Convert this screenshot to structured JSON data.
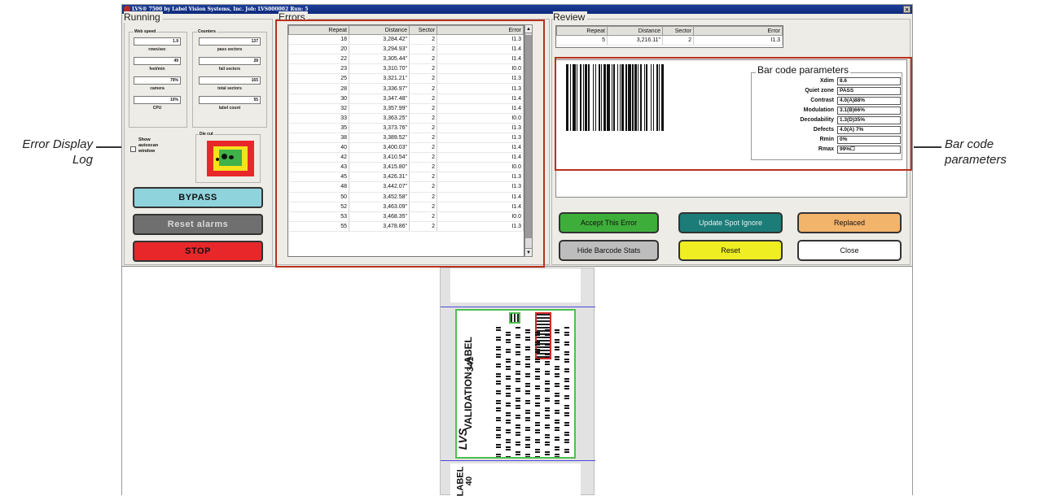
{
  "window": {
    "title": "LVS® 7500 by Label Vision Systems, Inc.   Job: LVS000002   Run: 5",
    "close_glyph": "×"
  },
  "running": {
    "title": "Running",
    "web_speed_title": "Web speed",
    "counters_title": "Counters",
    "rows_per_sec": {
      "value": "1.9",
      "label": "rows/sec"
    },
    "feet_per_min": {
      "value": "49",
      "label": "feet/min"
    },
    "camera": {
      "value": "79%",
      "label": "camera"
    },
    "cpu": {
      "value": "10%",
      "label": "CPU"
    },
    "pass_sectors": {
      "value": "137",
      "label": "pass sectors"
    },
    "fail_sectors": {
      "value": "28",
      "label": "fail sectors"
    },
    "total_sectors": {
      "value": "165",
      "label": "total sectors"
    },
    "label_count": {
      "value": "55",
      "label": "label count"
    },
    "show_autoscan_label": "Show autoscan window",
    "die_cut_title": "Die cut",
    "bypass_label": "BYPASS",
    "reset_alarms_label": "Reset alarms",
    "stop_label": "STOP"
  },
  "errors": {
    "title": "Errors",
    "columns": [
      "Repeat",
      "Distance",
      "Sector",
      "Error"
    ],
    "rows": [
      [
        "18",
        "3,284.42\"",
        "2",
        "I1.3"
      ],
      [
        "20",
        "3,294.93\"",
        "2",
        "I1.4"
      ],
      [
        "22",
        "3,305.44\"",
        "2",
        "I1.4"
      ],
      [
        "23",
        "3,310.70\"",
        "2",
        "I0.0"
      ],
      [
        "25",
        "3,321.21\"",
        "2",
        "I1.3"
      ],
      [
        "28",
        "3,336.97\"",
        "2",
        "I1.3"
      ],
      [
        "30",
        "3,347.48\"",
        "2",
        "I1.4"
      ],
      [
        "32",
        "3,357.99\"",
        "2",
        "I1.4"
      ],
      [
        "33",
        "3,363.25\"",
        "2",
        "I0.0"
      ],
      [
        "35",
        "3,373.76\"",
        "2",
        "I1.3"
      ],
      [
        "38",
        "3,389.52\"",
        "2",
        "I1.3"
      ],
      [
        "40",
        "3,400.03\"",
        "2",
        "I1.4"
      ],
      [
        "42",
        "3,410.54\"",
        "2",
        "I1.4"
      ],
      [
        "43",
        "3,415.80\"",
        "2",
        "I0.0"
      ],
      [
        "45",
        "3,426.31\"",
        "2",
        "I1.3"
      ],
      [
        "48",
        "3,442.07\"",
        "2",
        "I1.3"
      ],
      [
        "50",
        "3,452.58\"",
        "2",
        "I1.4"
      ],
      [
        "52",
        "3,463.09\"",
        "2",
        "I1.4"
      ],
      [
        "53",
        "3,468.35\"",
        "2",
        "I0.0"
      ],
      [
        "55",
        "3,478.86\"",
        "2",
        "I1.3"
      ]
    ]
  },
  "review": {
    "title": "Review",
    "columns": [
      "Repeat",
      "Distance",
      "Sector",
      "Error"
    ],
    "row": [
      "5",
      "3,216.11\"",
      "2",
      "I1.3"
    ]
  },
  "barcode_params": {
    "title": "Bar code parameters",
    "items": [
      {
        "name": "Xdim",
        "value": "8.6"
      },
      {
        "name": "Quiet zone",
        "value": "PASS"
      },
      {
        "name": "Contrast",
        "value": "4.0(A)88%"
      },
      {
        "name": "Modulation",
        "value": "3.1(B)66%"
      },
      {
        "name": "Decodability",
        "value": "1.3(D)35%"
      },
      {
        "name": "Defects",
        "value": "4.0(A) 7%"
      },
      {
        "name": "Rmin",
        "value": "0%"
      },
      {
        "name": "Rmax",
        "value": "99%☐"
      }
    ]
  },
  "actions": {
    "accept": "Accept This Error",
    "update_spot": "Update Spot Ignore",
    "replaced": "Replaced",
    "hide_stats": "Hide Barcode Stats",
    "reset": "Reset",
    "close": "Close"
  },
  "label_image": {
    "validation_text": "VALIDATION LABEL",
    "number_text": "341",
    "logo_text": "LVS",
    "bottom_label_text": "LABEL",
    "bottom_number_text": "40"
  },
  "annotations": {
    "error_log": "Error Display Log",
    "barcode_params": "Bar code parameters"
  },
  "colors": {
    "bypass": "#8fd3dd",
    "reset_alarms": "#6f6f6f",
    "stop": "#e8272b",
    "accept": "#3eae3a",
    "update_spot": "#1c7c78",
    "replaced": "#f2b36b",
    "hide_stats": "#bdbdbd",
    "reset": "#eeee22",
    "close": "#ffffff",
    "callout": "#b8321f"
  }
}
